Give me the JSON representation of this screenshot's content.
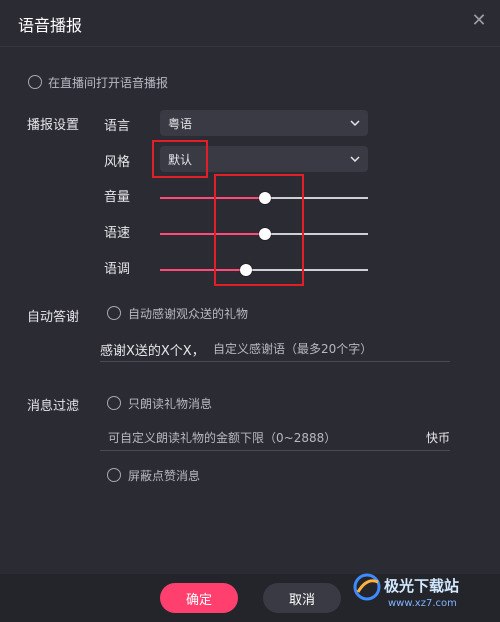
{
  "title": "语音播报",
  "top_toggle": {
    "label": "在直播间打开语音播报"
  },
  "broadcast": {
    "section_label": "播报设置",
    "language": {
      "label": "语言",
      "value": "粤语"
    },
    "style": {
      "label": "风格",
      "value": "默认"
    },
    "sliders": [
      {
        "label": "音量",
        "value": 50
      },
      {
        "label": "语速",
        "value": 50
      },
      {
        "label": "语调",
        "value": 40
      }
    ]
  },
  "auto_thanks": {
    "section_label": "自动答谢",
    "option": "自动感谢观众送的礼物",
    "message": "感谢X送的X个X，",
    "placeholder": "自定义感谢语（最多20个字）"
  },
  "filter": {
    "section_label": "消息过滤",
    "gift_only": "只朗读礼物消息",
    "min_amount_placeholder": "可自定义朗读礼物的金额下限（0~2888）",
    "unit": "快币",
    "block_likes": "屏蔽点赞消息"
  },
  "footer": {
    "confirm": "确定",
    "cancel": "取消"
  },
  "watermark": {
    "text": "极光下载站",
    "url": "www.xz7.com"
  },
  "colors": {
    "accent": "#ff3f6d",
    "highlight_box": "#e21f26",
    "background": "#2b2b33"
  }
}
